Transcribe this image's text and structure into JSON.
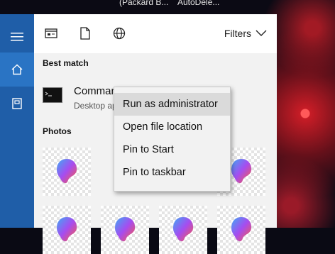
{
  "taskbar": {
    "items": [
      "(Packard B...",
      "AutoDele..."
    ]
  },
  "rail": {
    "menu_icon": "hamburger-icon",
    "home_icon": "home-icon",
    "notebook_icon": "notebook-icon"
  },
  "toolbar": {
    "filters_label": "Filters"
  },
  "results": {
    "best_match_heading": "Best match",
    "best_match_title": "Command Prompt",
    "best_match_subtitle": "Desktop app",
    "photos_heading": "Photos"
  },
  "context_menu": {
    "items": [
      "Run as administrator",
      "Open file location",
      "Pin to Start",
      "Pin to taskbar"
    ],
    "highlighted_index": 0
  },
  "colors": {
    "rail": "#1f5ea8",
    "rail_active": "#2a74c4",
    "panel": "#f2f2f2",
    "menu_hover": "#dadada"
  }
}
